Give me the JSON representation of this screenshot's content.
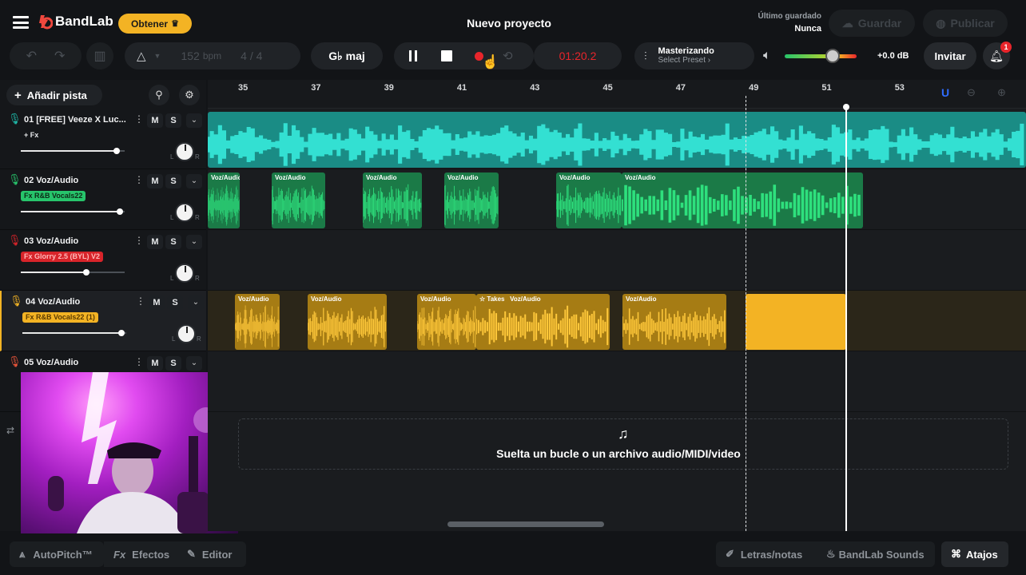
{
  "app": {
    "logo": "BandLab",
    "get_label": "Obtener",
    "project_title": "Nuevo proyecto",
    "last_saved_label": "Último guardado",
    "last_saved_value": "Nunca",
    "save_label": "Guardar",
    "publish_label": "Publicar",
    "notifications_count": "1"
  },
  "transport": {
    "tempo_value": "152",
    "tempo_unit": "bpm",
    "time_signature": "4 / 4",
    "key": "G♭ maj",
    "time": "01:20.2",
    "mastering_title": "Masterizando",
    "mastering_preset": "Select Preset",
    "volume_db": "+0.0 dB",
    "invite_label": "Invitar"
  },
  "left": {
    "add_track_label": "Añadir pista"
  },
  "tracks": [
    {
      "name": "01  [FREE] Veeze X Luc...",
      "fx": "+ Fx",
      "volume": 0.92,
      "color": "#1fb8a8"
    },
    {
      "name": "02  Voz/Audio",
      "fx": "Fx R&B Vocals22",
      "volume": 0.95,
      "color": "#27c46b"
    },
    {
      "name": "03  Voz/Audio",
      "fx": "Fx Glorry 2.5 (BYL) V2",
      "volume": 0.63,
      "color": "#d8242a"
    },
    {
      "name": "04  Voz/Audio",
      "fx": "Fx R&B Vocals22 (1)",
      "volume": 0.95,
      "color": "#f3b324"
    },
    {
      "name": "05  Voz/Audio",
      "fx": "",
      "volume": 0.5,
      "color": "#e8543a"
    }
  ],
  "track_buttons": {
    "mute": "M",
    "solo": "S",
    "left": "L",
    "right": "R"
  },
  "ruler": {
    "bars": [
      "35",
      "37",
      "39",
      "41",
      "43",
      "45",
      "47",
      "49",
      "51",
      "53"
    ]
  },
  "clip_label": "Voz/Audio",
  "takes_label": "Takes",
  "drop_text": "Suelta un bucle o un archivo audio/MIDI/video",
  "bottom": {
    "autopitch": "AutoPitch™",
    "effects": "Efectos",
    "editor": "Editor",
    "lyrics": "Letras/notas",
    "sounds": "BandLab Sounds",
    "shortcuts": "Atajos"
  },
  "colors": {
    "accent_yellow": "#f3b324",
    "record_red": "#e8252b",
    "teal": "#1fb8a8",
    "green": "#27c46b"
  }
}
